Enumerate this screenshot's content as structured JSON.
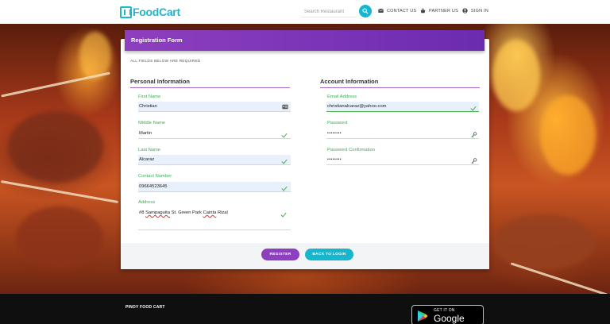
{
  "header": {
    "logo_text": "FoodCart",
    "search_placeholder": "Search Restaurant",
    "nav": {
      "contact": "CONTACT US",
      "partner": "PARTNER US",
      "signin": "SIGN IN"
    }
  },
  "form": {
    "title": "Registration Form",
    "required_note": "ALL FIELDS BELOW ARE REQUIRED",
    "personal": {
      "title": "Personal Information",
      "first_name": {
        "label": "First Name",
        "value": "Christian"
      },
      "middle_name": {
        "label": "Middle Name",
        "value": "Martin"
      },
      "last_name": {
        "label": "Last Name",
        "value": "Alcaraz"
      },
      "contact": {
        "label": "Contact Number",
        "value": "09664523645"
      },
      "address": {
        "label": "Address",
        "value_parts": [
          "#8 ",
          "Sampaguita",
          " St. Green Park ",
          "Cainta",
          " Rizal"
        ]
      }
    },
    "account": {
      "title": "Account Information",
      "email": {
        "label": "Email Address",
        "value": "christianalcaraz@yahoo.com"
      },
      "password": {
        "label": "Password",
        "value": "••••••••"
      },
      "password_confirm": {
        "label": "Password Confirmation",
        "value": "••••••••"
      }
    },
    "buttons": {
      "register": "REGISTER",
      "back": "BACK TO LOGIN"
    }
  },
  "footer": {
    "brand": "PINOY FOOD CART",
    "store_small": "GET IT ON",
    "store_big": "Google Play"
  },
  "colors": {
    "accent_teal": "#17b6cd",
    "accent_purple": "#8e3fbf",
    "valid_green": "#4caf50"
  }
}
